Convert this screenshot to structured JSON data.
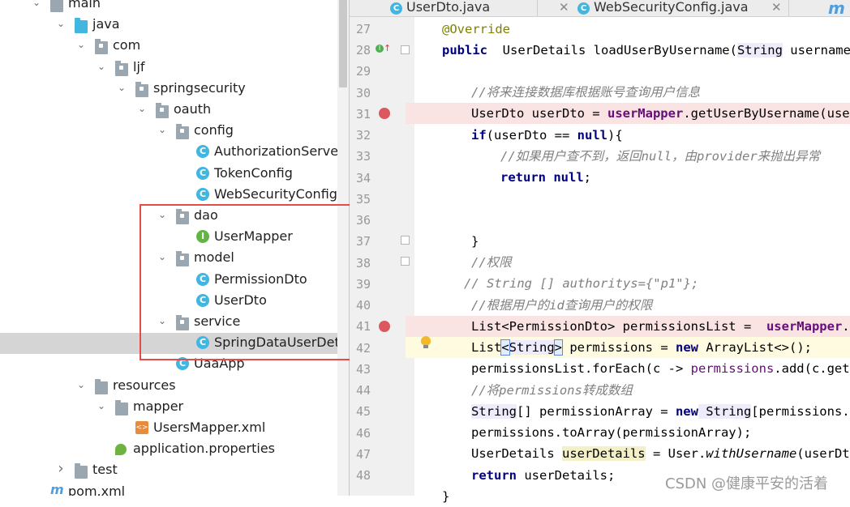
{
  "tree": [
    {
      "label": "main",
      "level": 0,
      "arrow": "expanded",
      "icon": "folder"
    },
    {
      "label": "java",
      "level": 1,
      "arrow": "expanded",
      "icon": "folder-blue"
    },
    {
      "label": "com",
      "level": 2,
      "arrow": "expanded",
      "icon": "package"
    },
    {
      "label": "ljf",
      "level": 3,
      "arrow": "expanded",
      "icon": "package"
    },
    {
      "label": "springsecurity",
      "level": 4,
      "arrow": "expanded",
      "icon": "package"
    },
    {
      "label": "oauth",
      "level": 5,
      "arrow": "expanded",
      "icon": "package"
    },
    {
      "label": "config",
      "level": 6,
      "arrow": "expanded",
      "icon": "package"
    },
    {
      "label": "AuthorizationServer",
      "level": 7,
      "arrow": "none",
      "icon": "class"
    },
    {
      "label": "TokenConfig",
      "level": 7,
      "arrow": "none",
      "icon": "class"
    },
    {
      "label": "WebSecurityConfig",
      "level": 7,
      "arrow": "none",
      "icon": "class"
    },
    {
      "label": "dao",
      "level": 6,
      "arrow": "expanded",
      "icon": "package"
    },
    {
      "label": "UserMapper",
      "level": 7,
      "arrow": "none",
      "icon": "interface"
    },
    {
      "label": "model",
      "level": 6,
      "arrow": "expanded",
      "icon": "package"
    },
    {
      "label": "PermissionDto",
      "level": 7,
      "arrow": "none",
      "icon": "class"
    },
    {
      "label": "UserDto",
      "level": 7,
      "arrow": "none",
      "icon": "class"
    },
    {
      "label": "service",
      "level": 6,
      "arrow": "expanded",
      "icon": "package"
    },
    {
      "label": "SpringDataUserDetails",
      "level": 7,
      "arrow": "none",
      "icon": "class",
      "selected": true
    },
    {
      "label": "UaaApp",
      "level": 6,
      "arrow": "none",
      "icon": "class-app"
    },
    {
      "label": "resources",
      "level": 2,
      "arrow": "expanded",
      "icon": "folder-res"
    },
    {
      "label": "mapper",
      "level": 3,
      "arrow": "expanded",
      "icon": "folder"
    },
    {
      "label": "UsersMapper.xml",
      "level": 4,
      "arrow": "none",
      "icon": "xml"
    },
    {
      "label": "application.properties",
      "level": 3,
      "arrow": "none",
      "icon": "properties"
    },
    {
      "label": "test",
      "level": 1,
      "arrow": "collapsed",
      "icon": "folder"
    },
    {
      "label": "pom.xml",
      "level": 0,
      "arrow": "none",
      "icon": "maven"
    }
  ],
  "tabs": [
    {
      "label": "UserDto.java"
    },
    {
      "label": "WebSecurityConfig.java"
    }
  ],
  "tab_overflow_icon": "maven-m-icon",
  "line_numbers": [
    "27",
    "28",
    "29",
    "30",
    "31",
    "32",
    "33",
    "34",
    "35",
    "36",
    "37",
    "38",
    "39",
    "40",
    "41",
    "42",
    "43",
    "44",
    "45",
    "46",
    "47",
    "48"
  ],
  "breakpoint_lines": [
    "31",
    "41"
  ],
  "code": {
    "l27": "@Override",
    "l28_kw": "public",
    "l28_rest": " UserDetails loadUserByUsername(",
    "l28_type": "String",
    "l28_tail": " username) t",
    "l30": "//将来连接数据库根据账号查询用户信息",
    "l31_a": "UserDto userDto = ",
    "l31_f": "userMapper",
    "l31_b": ".getUserByUsername(usern",
    "l32_kw": "if",
    "l32_a": "(userDto == ",
    "l32_null": "null",
    "l32_b": "){",
    "l33": "//如果用户查不到，返回null，由provider来抛出异常",
    "l34_kw": "return",
    "l34_null": " null",
    "l34_b": ";",
    "l37": "}",
    "l38": "//权限",
    "l39": "// String [] authoritys={\"p1\"};",
    "l40": "//根据用户的id查询用户的权限",
    "l41_a": "List<PermissionDto> permissionsList =  ",
    "l41_f": "userMapper",
    "l41_b": ".fi",
    "l42_a": "List",
    "l42_lt": "<",
    "l42_type": "String",
    "l42_gt": ">",
    "l42_b": " permissions = ",
    "l42_new": "new",
    "l42_c": " ArrayList<>();",
    "l43_a": "permissionsList.forEach(c -> ",
    "l43_m": "permissions",
    "l43_b": ".add(c.getCo",
    "l44": "//将permissions转成数组",
    "l45_type": "String",
    "l45_a": "[] permissionArray = ",
    "l45_new": "new",
    "l45_type2": " String",
    "l45_b": "[permissions.si",
    "l46": "permissions.toArray(permissionArray);",
    "l47_a": "UserDetails ",
    "l47_ud": "userDetails",
    "l47_b": " = User.",
    "l47_it": "withUsername",
    "l47_c": "(userDto.",
    "l48_kw": "return",
    "l48_b": " userDetails;",
    "l49": "}"
  },
  "watermark": "CSDN @健康平安的活着",
  "colors": {
    "highlight_box": "#e64a4a",
    "breakpoint": "#db5860",
    "keyword": "#000080",
    "field": "#660e7a",
    "comment": "#808080"
  }
}
